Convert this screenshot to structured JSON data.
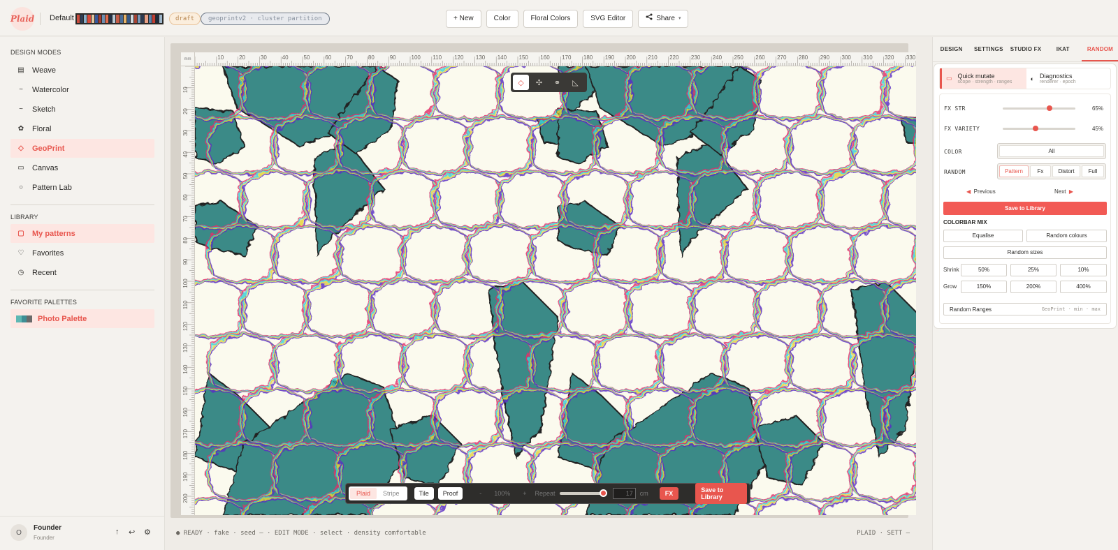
{
  "header": {
    "logo_text": "Plaid",
    "workspace": "Default",
    "draft_badge": "draft",
    "mode_badge": "geoprintv2 · cluster partition",
    "swatch_colors": [
      "#c94c3e",
      "#2f3e56",
      "#8bb0c9",
      "#d84a3a",
      "#e2c6a0",
      "#37589c",
      "#a33c2f",
      "#6d8fb1",
      "#e06a4c",
      "#243146",
      "#b9c9d6",
      "#c55c48",
      "#4a6d98",
      "#e7b46b",
      "#365886",
      "#d1d9e0",
      "#a54233",
      "#7a98b8",
      "#2d3a50",
      "#e9a085",
      "#5a7fa8",
      "#c23e32",
      "#1f2a3b",
      "#9fb7cb"
    ],
    "actions": {
      "new": "+ New",
      "color": "Color",
      "floral_colors": "Floral Colors",
      "svg_editor": "SVG Editor",
      "share": "Share"
    }
  },
  "sidebar": {
    "design_modes_title": "DESIGN MODES",
    "modes": [
      {
        "label": "Weave",
        "icon": "▤"
      },
      {
        "label": "Watercolor",
        "icon": "~"
      },
      {
        "label": "Sketch",
        "icon": "~"
      },
      {
        "label": "Floral",
        "icon": "✿"
      },
      {
        "label": "GeoPrint",
        "icon": "◇"
      },
      {
        "label": "Canvas",
        "icon": "▭"
      },
      {
        "label": "Pattern Lab",
        "icon": "○"
      }
    ],
    "library_title": "LIBRARY",
    "library": [
      {
        "label": "My patterns",
        "icon": "▢"
      },
      {
        "label": "Favorites",
        "icon": "♡"
      },
      {
        "label": "Recent",
        "icon": "◷"
      }
    ],
    "palettes_title": "FAVORITE PALETTES",
    "palette": {
      "label": "Photo Palette",
      "colors": [
        "#5fb7b3",
        "#3f8e95",
        "#6a6a6a"
      ]
    },
    "user": {
      "initial": "O",
      "name": "Founder",
      "role": "Founder"
    }
  },
  "canvas": {
    "ruler_unit": "mm",
    "pattern_colors": {
      "teal": "#3b8a87",
      "cream": "#fbfaee"
    },
    "bottom": {
      "plaid": "Plaid",
      "stripe": "Stripe",
      "tile": "Tile",
      "proof": "Proof",
      "zoom_minus": "-",
      "zoom": "100%",
      "zoom_plus": "+",
      "repeat_label": "Repeat",
      "repeat_value": "17",
      "unit": "cm",
      "fx": "FX",
      "save": "Save to Library"
    }
  },
  "status": {
    "left": "● READY · fake · seed — · EDIT MODE · select · density comfortable",
    "right": "PLAID · SETT —"
  },
  "right_panel": {
    "tabs": [
      "DESIGN",
      "SETTINGS",
      "STUDIO FX",
      "IKAT",
      "RANDOM"
    ],
    "quick_mutate": {
      "title": "Quick mutate",
      "sub": "scope · strength · ranges"
    },
    "diagnostics": {
      "title": "Diagnostics",
      "sub": "renderer · epoch"
    },
    "fx_str": {
      "label": "FX STR",
      "value": "65%"
    },
    "fx_variety": {
      "label": "FX VARIETY",
      "value": "45%"
    },
    "color_label": "COLOR",
    "color_value": "All",
    "random_label": "RANDOM",
    "random_options": [
      "Pattern",
      "Fx",
      "Distort",
      "Full"
    ],
    "previous": "Previous",
    "next": "Next",
    "save": "Save to Library",
    "colorbar_title": "COLORBAR MIX",
    "equalise": "Equalise",
    "random_colours": "Random colours",
    "random_sizes": "Random sizes",
    "shrink_label": "Shrink",
    "shrink": [
      "50%",
      "25%",
      "10%"
    ],
    "grow_label": "Grow",
    "grow": [
      "150%",
      "200%",
      "400%"
    ],
    "ranges_label": "Random Ranges",
    "ranges_sub": "GeoPrint · min · max"
  }
}
